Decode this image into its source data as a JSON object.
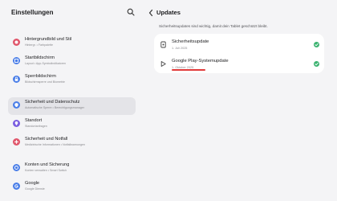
{
  "settings": {
    "title": "Einstellungen",
    "items": [
      {
        "label": "Hintergrundbild und Stil",
        "sub": "Hintergr. • Farbpalette",
        "icon": "palette-icon",
        "color": "#e0566b"
      },
      {
        "label": "Startbildschirm",
        "sub": "Layout • App-Symbolindikatoren",
        "icon": "home-icon",
        "color": "#4a7ee8"
      },
      {
        "label": "Sperrbildschirm",
        "sub": "Bildschirmsperre und Biometrie",
        "icon": "lock-icon",
        "color": "#4a7ee8"
      },
      {
        "label": "Sicherheit und Datenschutz",
        "sub": "Automatische Sperre • Berechtigungsmanager",
        "icon": "shield-icon",
        "color": "#4a7ee8"
      },
      {
        "label": "Standort",
        "sub": "Standortanfragen",
        "icon": "location-icon",
        "color": "#7b5fe0"
      },
      {
        "label": "Sicherheit und Notfall",
        "sub": "Medizinische Informationen • Notfallwarnungen",
        "icon": "emergency-icon",
        "color": "#e0566b"
      },
      {
        "label": "Konten und Sicherung",
        "sub": "Konten verwalten • Smart Switch",
        "icon": "sync-icon",
        "color": "#4a7ee8"
      },
      {
        "label": "Google",
        "sub": "Google Dienste",
        "icon": "google-icon",
        "color": "#4a7ee8"
      }
    ]
  },
  "updates": {
    "title": "Updates",
    "description": "Sicherheitsupdates sind wichtig, damit dein Tablet geschützt bleibt.",
    "items": [
      {
        "label": "Sicherheitsupdate",
        "date": "1. Juli 2025",
        "icon": "security-update-icon",
        "status": "check-icon"
      },
      {
        "label": "Google Play-Systemupdate",
        "date": "1. Oktober 2025",
        "icon": "play-icon",
        "status": "check-icon"
      }
    ]
  },
  "colors": {
    "accent_check": "#3cb371",
    "annotation_underline": "#e03a3a"
  }
}
